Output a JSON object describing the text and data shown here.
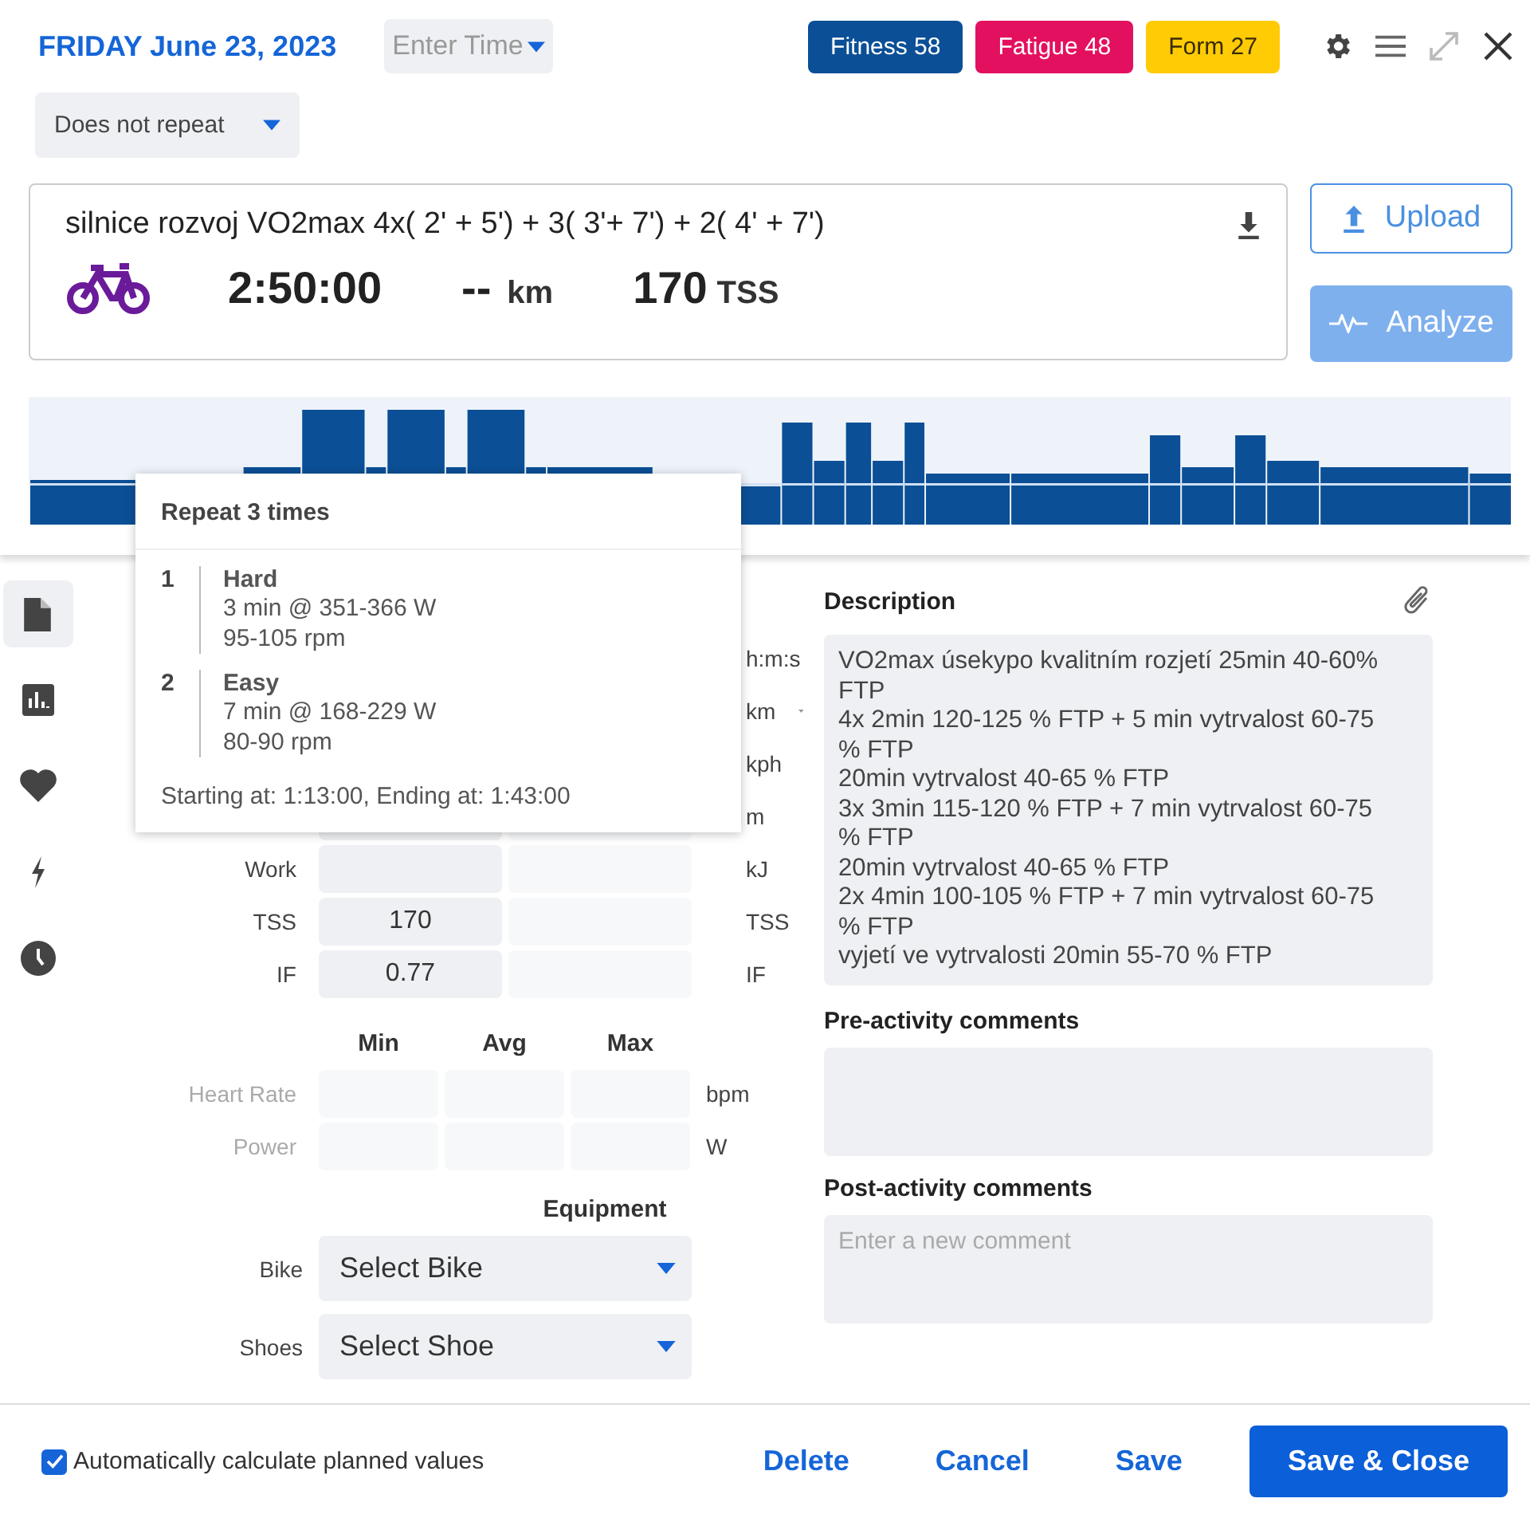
{
  "header": {
    "date": "FRIDAY June 23, 2023",
    "time_picker": {
      "placeholder": "Enter Time"
    },
    "badges": [
      {
        "label": "Fitness 58",
        "color": "#0b4f96"
      },
      {
        "label": "Fatigue 48",
        "color": "#e3105f"
      },
      {
        "label": "Form 27",
        "color": "#ffcb05"
      }
    ],
    "repeat": "Does not repeat"
  },
  "workout": {
    "title": "silnice rozvoj VO2max 4x( 2' + 5') + 3( 3'+ 7') + 2( 4' + 7')",
    "duration": "2:50:00",
    "distance": "--",
    "distance_unit": "km",
    "tss": "170",
    "tss_unit": "TSS"
  },
  "actions": [
    {
      "label": "Upload",
      "kind": "outline"
    },
    {
      "label": "Analyze",
      "kind": "filled"
    }
  ],
  "tooltip": {
    "title": "Repeat 3 times",
    "steps": [
      {
        "number": "1",
        "name": "Hard",
        "lines": [
          "3 min @ 351-366 W",
          "95-105 rpm"
        ]
      },
      {
        "number": "2",
        "name": "Easy",
        "lines": [
          "7 min @ 168-229 W",
          "80-90 rpm"
        ]
      }
    ],
    "footer": "Starting at: 1:13:00, Ending at: 1:43:00"
  },
  "sidebar": [
    {
      "kind": "document",
      "selected": true
    },
    {
      "kind": "chart",
      "selected": false
    },
    {
      "kind": "heart",
      "selected": false
    },
    {
      "kind": "bolt",
      "selected": false
    },
    {
      "kind": "clock",
      "selected": false
    }
  ],
  "summary_rows": [
    {
      "unit": "h:m:s"
    },
    {
      "unit": "km",
      "kind": "select"
    },
    {
      "unit": "kph"
    },
    {
      "unit": "m"
    },
    {
      "label": "Work",
      "unit": "kJ"
    },
    {
      "label": "TSS",
      "planned": "170",
      "unit": "TSS"
    },
    {
      "label": "IF",
      "planned": "0.77",
      "unit": "IF"
    }
  ],
  "range": {
    "columns": [
      "Min",
      "Avg",
      "Max"
    ],
    "rows": [
      {
        "label": "Heart Rate",
        "unit": "bpm",
        "disabled": true
      },
      {
        "label": "Power",
        "unit": "W",
        "disabled": true
      }
    ]
  },
  "equipment": {
    "title": "Equipment",
    "fields": [
      {
        "label": "Bike",
        "value": "Select Bike"
      },
      {
        "label": "Shoes",
        "value": "Select Shoe"
      }
    ]
  },
  "description": {
    "title": "Description",
    "text": "VO2max úsekypo kvalitním rozjetí 25min 40-60% FTP\n4x 2min 120-125 % FTP + 5 min vytrvalost 60-75 % FTP\n20min vytrvalost 40-65 % FTP\n3x 3min 115-120 % FTP + 7 min vytrvalost 60-75 % FTP\n20min vytrvalost 40-65 % FTP\n2x 4min 100-105 % FTP + 7 min vytrvalost 60-75 % FTP\nvyjetí ve vytrvalosti 20min 55-70 % FTP"
  },
  "pre_comments": {
    "title": "Pre-activity comments"
  },
  "post_comments": {
    "title": "Post-activity comments",
    "placeholder": "Enter a new comment"
  },
  "footer": {
    "auto_calc": {
      "label": "Automatically calculate planned values",
      "checked": true
    },
    "buttons": [
      {
        "label": "Delete",
        "kind": "text"
      },
      {
        "label": "Cancel",
        "kind": "text"
      },
      {
        "label": "Save",
        "kind": "text"
      },
      {
        "label": "Save & Close",
        "kind": "primary"
      }
    ]
  }
}
